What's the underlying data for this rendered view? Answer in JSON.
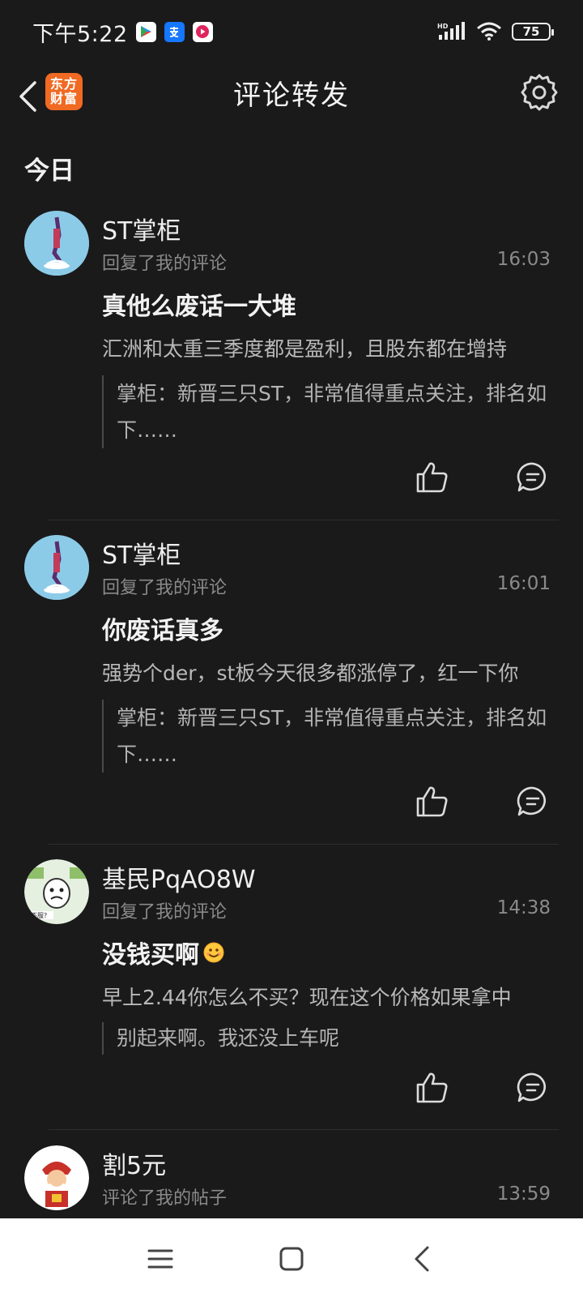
{
  "status_bar": {
    "time": "下午5:22",
    "app_icons": [
      "play-store-icon",
      "alipay-icon",
      "video-app-icon"
    ],
    "battery": "75",
    "indicators": [
      "hd-signal-icon",
      "wifi-icon",
      "battery-icon"
    ]
  },
  "header": {
    "logo_line1": "东方",
    "logo_line2": "财富",
    "title": "评论转发"
  },
  "section": {
    "title": "今日"
  },
  "items": [
    {
      "name": "ST掌柜",
      "subtitle": "回复了我的评论",
      "time": "16:03",
      "headline": "真他么废话一大堆",
      "body": "汇洲和太重三季度都是盈利，且股东都在增持",
      "quote": "掌柜：新晋三只ST，非常值得重点关注，排名如下……"
    },
    {
      "name": "ST掌柜",
      "subtitle": "回复了我的评论",
      "time": "16:01",
      "headline": "你废话真多",
      "body": "强势个der，st板今天很多都涨停了，红一下你",
      "quote": "掌柜：新晋三只ST，非常值得重点关注，排名如下……"
    },
    {
      "name": "基民PqAO8W",
      "subtitle": "回复了我的评论",
      "time": "14:38",
      "headline": "没钱买啊",
      "body": "早上2.44你怎么不买？现在这个价格如果拿中",
      "quote": "别起来啊。我还没上车呢"
    },
    {
      "name": "割5元",
      "subtitle": "评论了我的帖子",
      "time": "13:59"
    }
  ],
  "colors": {
    "background": "#1a1a1b",
    "brand": "#f06a23",
    "navbar": "#ffffff"
  }
}
